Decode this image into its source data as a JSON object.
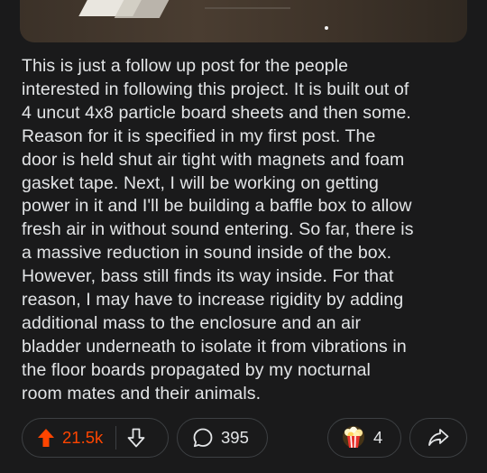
{
  "post": {
    "body_lines": [
      "This is just a follow up post for the people",
      "interested in following this project. It is built out of",
      "4 uncut 4x8 particle board sheets and then some.",
      "Reason for it is specified in my first post. The",
      "door is held shut air tight with magnets and foam",
      "gasket tape. Next, I will be working on getting",
      "power in it and I'll be building a baffle box to allow",
      "fresh air in without sound entering. So far, there is",
      "a massive reduction in sound inside of the box.",
      "However, bass still finds its way inside. For that",
      "reason, I may have to increase rigidity by adding",
      "additional mass to the enclosure and an air",
      "bladder underneath to isolate it from vibrations in",
      "the floor boards propagated by my nocturnal",
      "room mates and their animals."
    ]
  },
  "actions": {
    "upvote_count": "21.5k",
    "comment_count": "395",
    "award_count": "4"
  },
  "colors": {
    "background": "#1a1a1b",
    "text": "#e3e5e7",
    "upvote_accent": "#ff4500",
    "pill_border": "#3d4043"
  },
  "icons": [
    "upvote-arrow-icon",
    "downvote-arrow-icon",
    "comment-bubble-icon",
    "award-popcorn-icon",
    "share-arrow-icon"
  ]
}
